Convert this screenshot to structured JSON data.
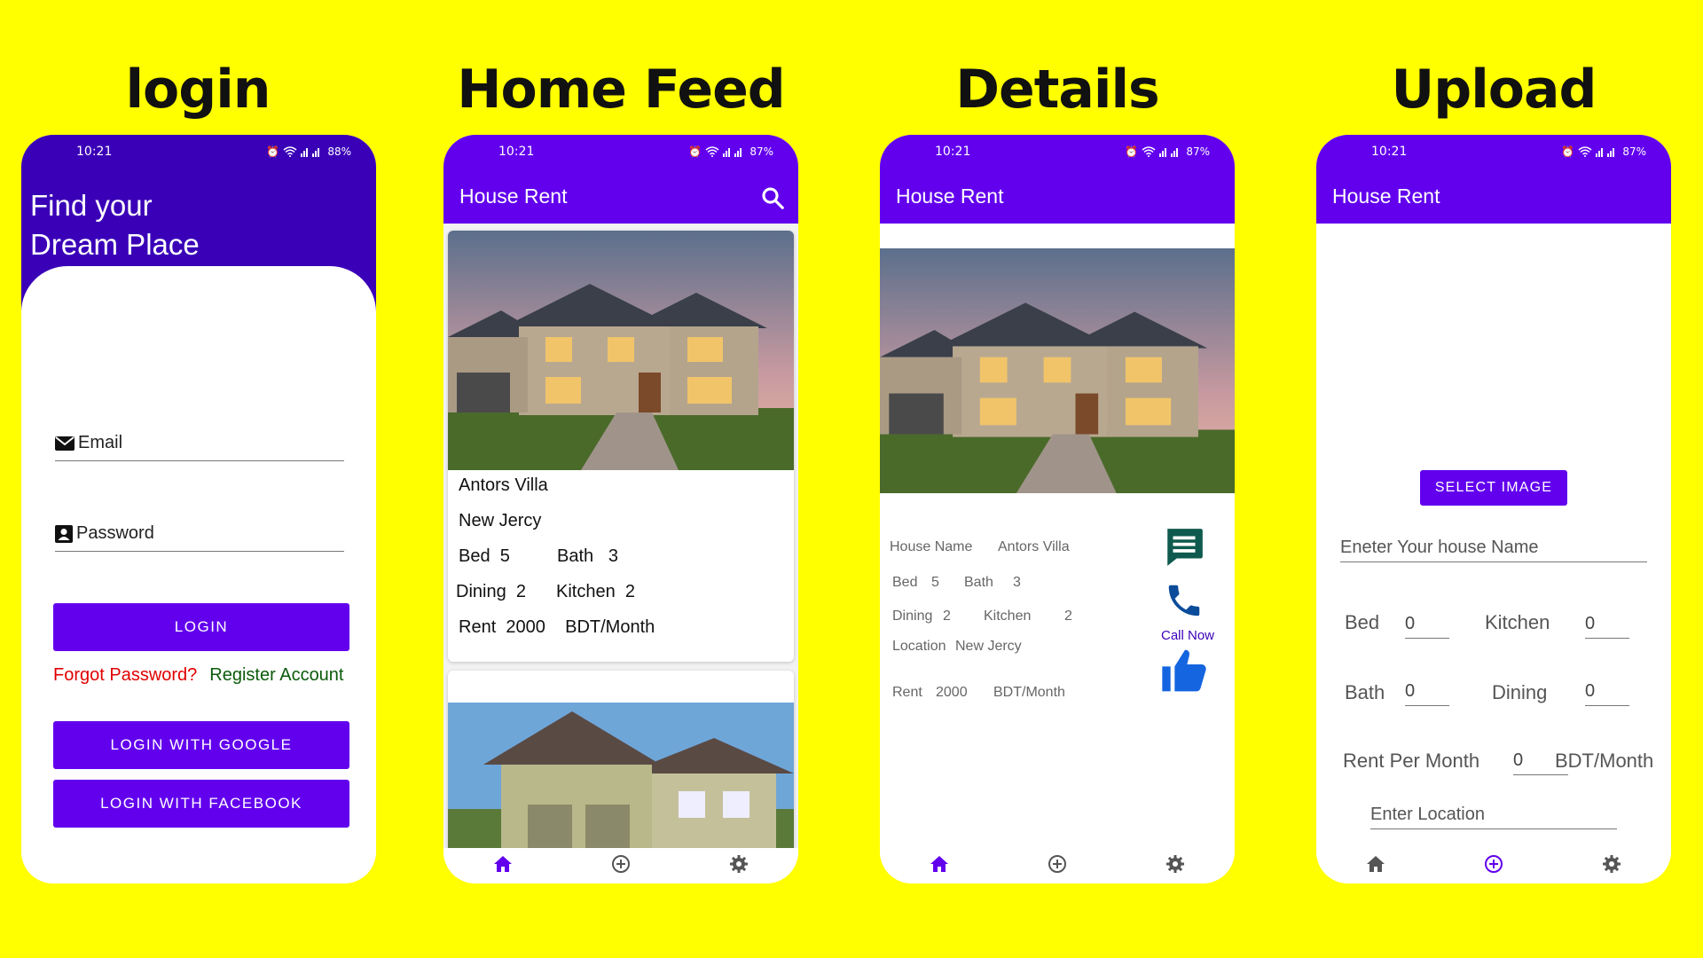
{
  "titles": {
    "login": "login",
    "feed": "Home Feed",
    "details": "Details",
    "upload": "Upload"
  },
  "status": {
    "time": "10:21",
    "battery_login": "88%",
    "battery": "87%"
  },
  "appbar": {
    "title": "House Rent"
  },
  "login": {
    "hero_line1": "Find your",
    "hero_line2": "Dream Place",
    "email_label": "Email",
    "password_label": "Password",
    "login_button": "LOGIN",
    "forgot": "Forgot Password?",
    "register": "Register Account",
    "google_button": "LOGIN WITH GOOGLE",
    "facebook_button": "LOGIN WITH FACEBOOK"
  },
  "feed": {
    "card1": {
      "name": "Antors Villa",
      "location": "New Jercy",
      "bed_label": "Bed",
      "bed": "5",
      "bath_label": "Bath",
      "bath": "3",
      "dining_label": "Dining",
      "dining": "2",
      "kitchen_label": "Kitchen",
      "kitchen": "2",
      "rent_label": "Rent",
      "rent": "2000",
      "unit": "BDT/Month"
    }
  },
  "details": {
    "house_name_label": "House Name",
    "house_name": "Antors Villa",
    "bed_label": "Bed",
    "bed": "5",
    "bath_label": "Bath",
    "bath": "3",
    "dining_label": "Dining",
    "dining": "2",
    "kitchen_label": "Kitchen",
    "kitchen": "2",
    "location_label": "Location",
    "location": "New Jercy",
    "rent_label": "Rent",
    "rent": "2000",
    "unit": "BDT/Month",
    "call_now": "Call Now"
  },
  "upload": {
    "select_image": "SELECT IMAGE",
    "house_name_placeholder": "Eneter Your house Name",
    "bed_label": "Bed",
    "bed": "0",
    "kitchen_label": "Kitchen",
    "kitchen": "0",
    "bath_label": "Bath",
    "bath": "0",
    "dining_label": "Dining",
    "dining": "0",
    "rent_label": "Rent Per Month",
    "rent": "0",
    "unit": "BDT/Month",
    "location_placeholder": "Enter Location"
  },
  "colors": {
    "background": "#FFFF00",
    "primary": "#6200EE",
    "login_header": "#3A00B8",
    "forgot": "#E00000",
    "register": "#0B5A0B",
    "message_icon": "#0E5A4E",
    "call_icon": "#0A4C9A",
    "like_icon": "#1565E0"
  },
  "icons": [
    "alarm-icon",
    "wifi-icon",
    "signal-icon",
    "search-icon",
    "email-icon",
    "person-card-icon",
    "message-icon",
    "phone-icon",
    "thumbs-up-icon",
    "home-icon",
    "add-circle-icon",
    "settings-icon"
  ]
}
